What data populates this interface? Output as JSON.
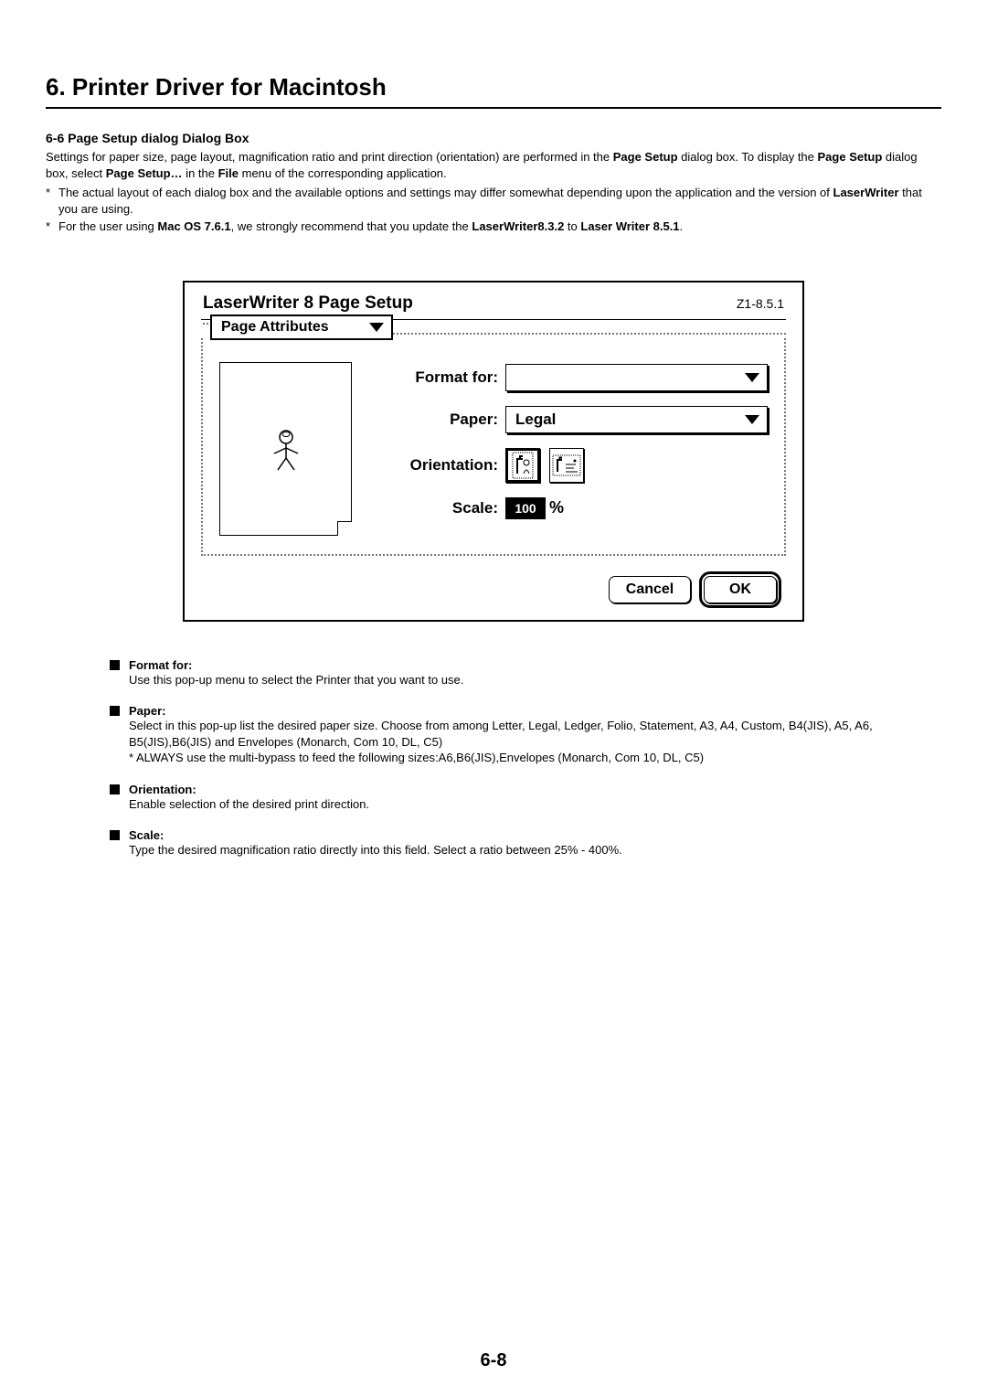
{
  "chapter": "6. Printer Driver for Macintosh",
  "section": "6-6 Page Setup dialog Dialog Box",
  "intro_before_bold1": "Settings for paper size, page layout, magnification ratio and print direction (orientation) are performed in the ",
  "intro_bold1": "Page Setup",
  "intro_after_bold1": " dialog box. To display the ",
  "intro_bold2": "Page Setup",
  "intro_after_bold2": " dialog box, select ",
  "intro_bold3": "Page Setup…",
  "intro_after_bold3": " in the ",
  "intro_bold4": "File",
  "intro_after_bold4": " menu of the corresponding application.",
  "note1_before": "The actual layout of each dialog box and the available options and settings may differ somewhat depending upon the application and the version of ",
  "note1_bold": "LaserWriter",
  "note1_after": " that you are using.",
  "note2_p1": "For the user using ",
  "note2_b1": "Mac OS 7.6.1",
  "note2_p2": ", we strongly recommend that you update the ",
  "note2_b2": "LaserWriter8.3.2",
  "note2_p3": " to ",
  "note2_b3": "Laser Writer 8.5.1",
  "note2_p4": ".",
  "dialog": {
    "title": "LaserWriter 8 Page Setup",
    "version": "Z1-8.5.1",
    "popup_section": "Page Attributes",
    "format_for_label": "Format for:",
    "format_for_value": "",
    "paper_label": "Paper:",
    "paper_value": "Legal",
    "orientation_label": "Orientation:",
    "scale_label": "Scale:",
    "scale_value": "100",
    "scale_suffix": "%",
    "cancel": "Cancel",
    "ok": "OK"
  },
  "defs": [
    {
      "title": "Format for:",
      "body": "Use this pop-up menu to select the Printer that you want  to use."
    },
    {
      "title": "Paper:",
      "body": " Select in this pop-up list the desired paper size. Choose from among Letter, Legal, Ledger, Folio, Statement, A3, A4, Custom, B4(JIS), A5, A6, B5(JIS),B6(JIS) and Envelopes (Monarch, Com 10, DL, C5)\n* ALWAYS use the multi-bypass to feed the following sizes:A6,B6(JIS),Envelopes (Monarch, Com 10, DL, C5)"
    },
    {
      "title": "Orientation:",
      "body": "Enable selection of the desired print direction."
    },
    {
      "title": "Scale:",
      "body": " Type the desired magnification ratio directly into this field. Select a ratio between 25% - 400%."
    }
  ],
  "page_number": "6-8"
}
